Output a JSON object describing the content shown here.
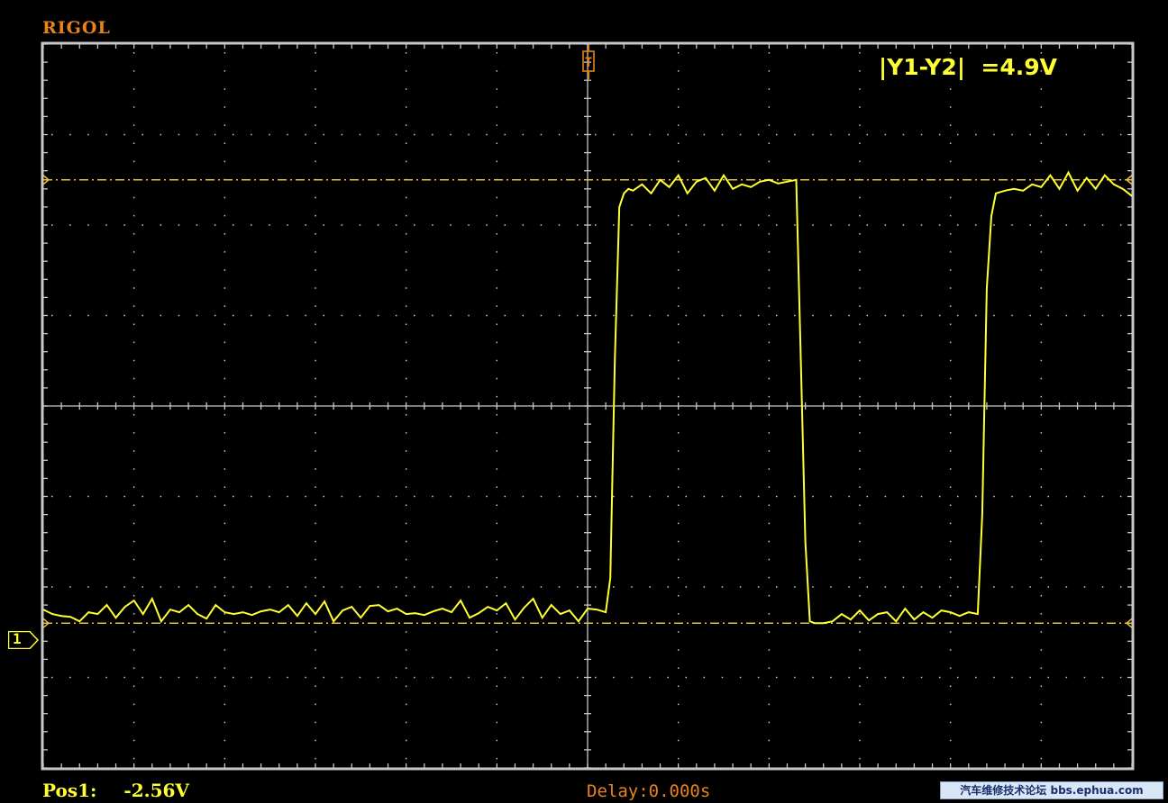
{
  "brand": "RIGOL",
  "measurement": "|Y1-Y2|  =4.9V",
  "channel_marker": "1",
  "trigger_marker": "T",
  "position_label": "Pos1:",
  "position_value": "-2.56V",
  "delay": "Delay:0.000s",
  "watermark": "汽车维修技术论坛 bbs.ephua.com",
  "colors": {
    "background": "#000000",
    "grid": "#c8c8c8",
    "trace": "#ffff33",
    "cursor": "#e8c040",
    "brand": "#e8821a"
  },
  "chart_data": {
    "type": "line",
    "title": "",
    "xlabel": "",
    "ylabel": "",
    "xlim": [
      0,
      12
    ],
    "ylim": [
      0,
      8
    ],
    "grid": true,
    "cursors": {
      "y1": 6.5,
      "y2": 1.6
    },
    "series": [
      {
        "x": [
          0.0,
          0.1,
          0.2,
          0.3,
          0.4,
          0.5,
          0.6,
          0.7,
          0.8,
          0.9,
          1.0,
          1.1,
          1.2,
          1.3,
          1.4,
          1.5,
          1.6,
          1.7,
          1.8,
          1.9,
          2.0,
          2.1,
          2.2,
          2.3,
          2.4,
          2.5,
          2.6,
          2.7,
          2.8,
          2.9,
          3.0,
          3.1,
          3.2,
          3.3,
          3.4,
          3.5,
          3.6,
          3.7,
          3.8,
          3.9,
          4.0,
          4.1,
          4.2,
          4.3,
          4.4,
          4.5,
          4.6,
          4.7,
          4.8,
          4.9,
          5.0,
          5.1,
          5.2,
          5.3,
          5.4,
          5.5,
          5.6,
          5.7,
          5.8,
          5.9,
          6.0,
          6.1,
          6.2,
          6.25,
          6.3,
          6.35,
          6.4,
          6.45,
          6.5,
          6.6,
          6.7,
          6.8,
          6.9,
          7.0,
          7.1,
          7.2,
          7.3,
          7.4,
          7.5,
          7.6,
          7.7,
          7.8,
          7.9,
          8.0,
          8.1,
          8.2,
          8.3,
          8.35,
          8.4,
          8.45,
          8.5,
          8.6,
          8.7,
          8.8,
          8.9,
          9.0,
          9.1,
          9.2,
          9.3,
          9.4,
          9.5,
          9.6,
          9.7,
          9.8,
          9.9,
          10.0,
          10.1,
          10.2,
          10.3,
          10.35,
          10.4,
          10.45,
          10.5,
          10.6,
          10.7,
          10.8,
          10.9,
          11.0,
          11.1,
          11.2,
          11.3,
          11.4,
          11.5,
          11.6,
          11.7,
          11.8,
          11.9,
          12.0
        ],
        "y": [
          1.75,
          1.7,
          1.68,
          1.67,
          1.62,
          1.72,
          1.7,
          1.8,
          1.66,
          1.78,
          1.85,
          1.7,
          1.87,
          1.62,
          1.75,
          1.72,
          1.8,
          1.7,
          1.65,
          1.8,
          1.72,
          1.7,
          1.72,
          1.69,
          1.73,
          1.75,
          1.72,
          1.8,
          1.68,
          1.82,
          1.7,
          1.84,
          1.62,
          1.74,
          1.78,
          1.66,
          1.79,
          1.8,
          1.73,
          1.76,
          1.7,
          1.71,
          1.69,
          1.73,
          1.76,
          1.72,
          1.85,
          1.66,
          1.71,
          1.78,
          1.74,
          1.82,
          1.64,
          1.77,
          1.87,
          1.66,
          1.8,
          1.7,
          1.74,
          1.62,
          1.76,
          1.75,
          1.72,
          2.1,
          4.5,
          6.2,
          6.35,
          6.4,
          6.38,
          6.45,
          6.35,
          6.5,
          6.42,
          6.55,
          6.35,
          6.48,
          6.52,
          6.38,
          6.55,
          6.4,
          6.45,
          6.42,
          6.48,
          6.5,
          6.46,
          6.48,
          6.5,
          4.5,
          2.5,
          1.62,
          1.6,
          1.6,
          1.62,
          1.7,
          1.64,
          1.74,
          1.63,
          1.7,
          1.72,
          1.62,
          1.76,
          1.64,
          1.72,
          1.66,
          1.74,
          1.72,
          1.68,
          1.72,
          1.7,
          2.8,
          5.3,
          6.1,
          6.35,
          6.38,
          6.4,
          6.38,
          6.45,
          6.42,
          6.55,
          6.4,
          6.58,
          6.38,
          6.52,
          6.4,
          6.55,
          6.45,
          6.4,
          6.32
        ]
      }
    ]
  }
}
